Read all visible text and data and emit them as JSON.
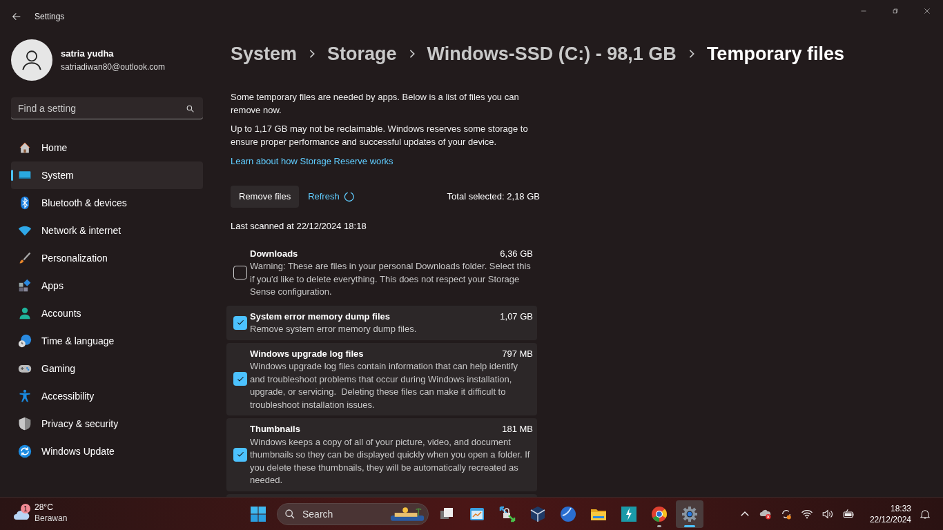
{
  "window": {
    "title": "Settings"
  },
  "account": {
    "name": "satria yudha",
    "email": "satriadiwan80@outlook.com"
  },
  "search": {
    "placeholder": "Find a setting"
  },
  "nav": [
    {
      "label": "Home",
      "selected": false
    },
    {
      "label": "System",
      "selected": true
    },
    {
      "label": "Bluetooth & devices",
      "selected": false
    },
    {
      "label": "Network & internet",
      "selected": false
    },
    {
      "label": "Personalization",
      "selected": false
    },
    {
      "label": "Apps",
      "selected": false
    },
    {
      "label": "Accounts",
      "selected": false
    },
    {
      "label": "Time & language",
      "selected": false
    },
    {
      "label": "Gaming",
      "selected": false
    },
    {
      "label": "Accessibility",
      "selected": false
    },
    {
      "label": "Privacy & security",
      "selected": false
    },
    {
      "label": "Windows Update",
      "selected": false
    }
  ],
  "breadcrumb": [
    "System",
    "Storage",
    "Windows-SSD (C:) - 98,1 GB",
    "Temporary files"
  ],
  "intro": [
    "Some temporary files are needed by apps. Below is a list of files you can remove now.",
    "Up to 1,17 GB may not be reclaimable. Windows reserves some storage to ensure proper performance and successful updates of your device."
  ],
  "learn_link": "Learn about how Storage Reserve works",
  "toolbar": {
    "remove_button": "Remove files",
    "refresh_link": "Refresh",
    "total_selected": "Total selected: 2,18 GB"
  },
  "last_scanned": "Last scanned at 22/12/2024 18:18",
  "file_groups": [
    {
      "name": "Downloads",
      "size": "6,36 GB",
      "description": "Warning: These are files in your personal Downloads folder. Select this if you'd like to delete everything. This does not respect your Storage Sense configuration.",
      "checked": false
    },
    {
      "name": "System error memory dump files",
      "size": "1,07 GB",
      "description": "Remove system error memory dump files.",
      "checked": true
    },
    {
      "name": "Windows upgrade log files",
      "size": "797 MB",
      "description": "Windows upgrade log files contain information that can help identify and troubleshoot problems that occur during Windows installation, upgrade, or servicing.  Deleting these files can make it difficult to troubleshoot installation issues.",
      "checked": true
    },
    {
      "name": "Thumbnails",
      "size": "181 MB",
      "description": "Windows keeps a copy of all of your picture, video, and document thumbnails so they can be displayed quickly when you open a folder. If you delete these thumbnails, they will be automatically recreated as needed.",
      "checked": true
    }
  ],
  "taskbar": {
    "weather": {
      "temperature": "28°C",
      "condition": "Berawan",
      "badge": "1"
    },
    "search": "Search",
    "apps": [
      {
        "running": false,
        "selected": false
      },
      {
        "running": false,
        "selected": false
      },
      {
        "running": false,
        "selected": false
      },
      {
        "running": false,
        "selected": false
      },
      {
        "running": false,
        "selected": false
      },
      {
        "running": false,
        "selected": false
      },
      {
        "running": false,
        "selected": false
      },
      {
        "running": true,
        "selected": false
      },
      {
        "running": true,
        "selected": true
      }
    ],
    "time": "18:33",
    "date": "22/12/2024"
  }
}
